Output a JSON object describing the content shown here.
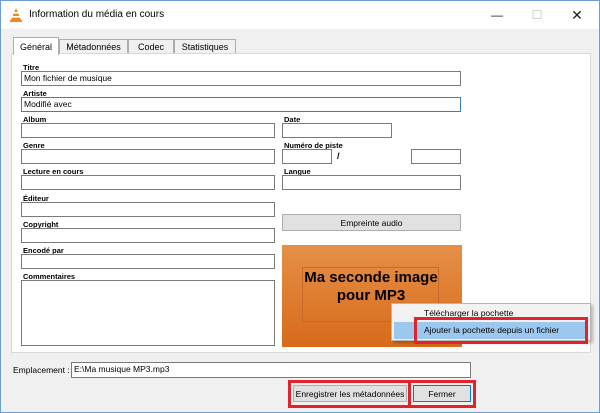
{
  "window": {
    "title": "Information du média en cours",
    "minimize": "—",
    "maximize": "☐",
    "close": "✕"
  },
  "tabs": [
    "Général",
    "Métadonnées",
    "Codec",
    "Statistiques"
  ],
  "fields": {
    "titre": {
      "label": "Titre",
      "value": "Mon fichier de musique"
    },
    "artiste": {
      "label": "Artiste",
      "value": "Modifié avec"
    },
    "album": {
      "label": "Album",
      "value": ""
    },
    "date": {
      "label": "Date",
      "value": ""
    },
    "genre": {
      "label": "Genre",
      "value": ""
    },
    "piste": {
      "label": "Numéro de piste",
      "value": "",
      "total": "",
      "separator": "/"
    },
    "lecture": {
      "label": "Lecture en cours",
      "value": ""
    },
    "langue": {
      "label": "Langue",
      "value": ""
    },
    "editeur": {
      "label": "Éditeur",
      "value": ""
    },
    "copyright": {
      "label": "Copyright",
      "value": ""
    },
    "encode": {
      "label": "Encodé par",
      "value": ""
    },
    "commentaires": {
      "label": "Commentaires",
      "value": ""
    }
  },
  "buttons": {
    "empreinte": "Empreinte audio",
    "enregistrer": "Enregistrer les métadonnées",
    "fermer": "Fermer"
  },
  "cover": {
    "text": "Ma seconde image pour MP3",
    "color_top": "#e59048",
    "color_bottom": "#d86a1a"
  },
  "context_menu": {
    "items": [
      "Télécharger la pochette",
      "Ajouter la pochette depuis un fichier"
    ]
  },
  "emplacement": {
    "label": "Emplacement :",
    "value": "E:\\Ma musique MP3.mp3"
  },
  "highlight_color": "#e3232c"
}
